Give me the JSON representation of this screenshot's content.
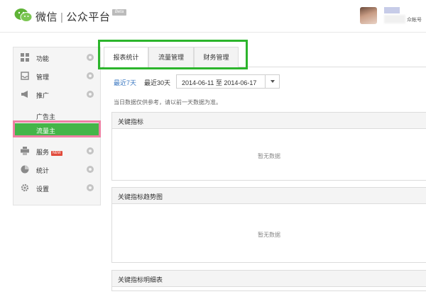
{
  "header": {
    "brand_name": "微信",
    "separator": "|",
    "platform_name": "公众平台",
    "beta_label": "Beta",
    "account_type": "众帐号"
  },
  "sidebar": {
    "items": [
      {
        "label": "功能",
        "icon": "grid-icon"
      },
      {
        "label": "管理",
        "icon": "inbox-icon"
      },
      {
        "label": "推广",
        "icon": "megaphone-icon"
      },
      {
        "label": "服务",
        "icon": "printer-icon",
        "badge": "NEW"
      },
      {
        "label": "统计",
        "icon": "pie-chart-icon"
      },
      {
        "label": "设置",
        "icon": "gear-icon"
      }
    ],
    "promo_sub": [
      {
        "label": "广告主"
      },
      {
        "label": "流量主",
        "active": true
      }
    ]
  },
  "tabs": [
    {
      "label": "报表统计",
      "active": true
    },
    {
      "label": "流量管理"
    },
    {
      "label": "财务管理"
    }
  ],
  "filters": {
    "recent7": "最近7天",
    "recent30": "最近30天",
    "date_range": "2014-06-11 至 2014-06-17"
  },
  "notice": "当日数据仅供参考，请以前一天数据为准。",
  "panels": [
    {
      "title": "关键指标",
      "empty_text": "暂无数据"
    },
    {
      "title": "关键指标趋势图",
      "empty_text": "暂无数据"
    },
    {
      "title": "关键指标明细表"
    }
  ],
  "colors": {
    "accent_green": "#44b549",
    "highlight_frame": "#2cb52c",
    "pink_frame": "#ef7fa4",
    "link_blue": "#3b78c2",
    "new_badge": "#e14b3b"
  }
}
